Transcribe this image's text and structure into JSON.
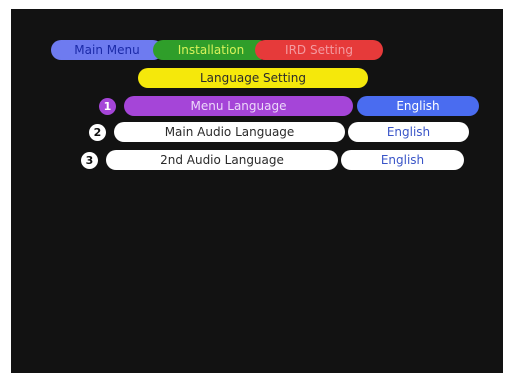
{
  "breadcrumb": [
    "Main Menu",
    "Installation",
    "IRD Setting"
  ],
  "section_title": "Language Setting",
  "rows": [
    {
      "number": "1",
      "label": "Menu Language",
      "value": "English"
    },
    {
      "number": "2",
      "label": "Main Audio Language",
      "value": "English"
    },
    {
      "number": "3",
      "label": "2nd Audio Language",
      "value": "English"
    }
  ],
  "colors": {
    "screen_background": "#121212",
    "breadcrumb_main_menu": "#6e7bf0",
    "breadcrumb_installation": "#2f9e2a",
    "breadcrumb_ird_setting": "#e63a3a",
    "section_title": "#f5e80b",
    "selected_label": "#a545d8",
    "selected_value": "#4a6cf0",
    "unselected": "#ffffff"
  }
}
